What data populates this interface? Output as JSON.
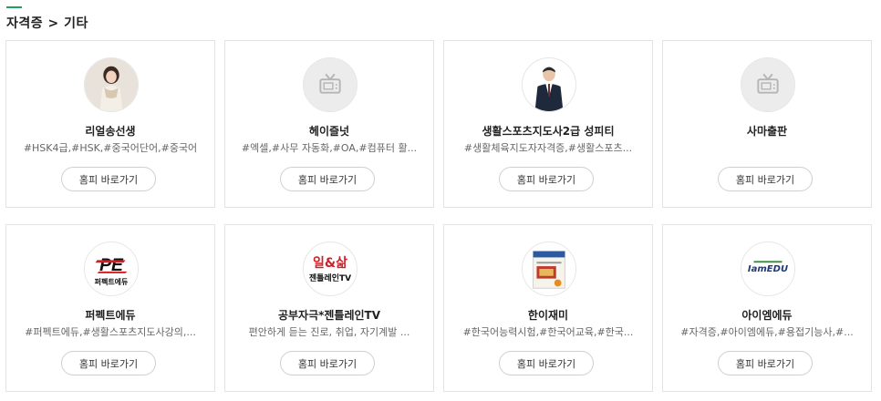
{
  "breadcrumb": "자격증 > 기타",
  "button_label": "홈피 바로가기",
  "accent_color": "#1aa35d",
  "cards": [
    {
      "name": "리얼송선생",
      "tags": "#HSK4급,#HSK,#중국어단어,#중국어",
      "icon": "person-woman-photo"
    },
    {
      "name": "헤이즐넛",
      "tags": "#엑셀,#사무 자동화,#OA,#컴퓨터 활...",
      "icon": "tv-icon"
    },
    {
      "name": "생활스포츠지도사2급 성피티",
      "tags": "#생활체육지도자자격증,#생활스포츠...",
      "icon": "person-man-photo"
    },
    {
      "name": "사마출판",
      "tags": "",
      "icon": "tv-icon"
    },
    {
      "name": "퍼펙트에듀",
      "tags": "#퍼펙트에듀,#생활스포츠지도사강의,...",
      "icon": "perfect-edu-logo",
      "logo_text": "퍼펙트에듀"
    },
    {
      "name": "공부자극*젠틀레인TV",
      "tags": "편안하게 듣는 진로, 취업, 자기계발 ...",
      "icon": "gentle-rain-logo",
      "logo_text_top": "일&삶",
      "logo_text_bottom": "젠틀레인TV"
    },
    {
      "name": "한이재미",
      "tags": "#한국어능력시험,#한국어교육,#한국...",
      "icon": "book-cover-image"
    },
    {
      "name": "아이엠에듀",
      "tags": "#자격증,#아이엠에듀,#용접기능사,#...",
      "icon": "iamedu-logo",
      "logo_text": "IamEDU"
    }
  ]
}
